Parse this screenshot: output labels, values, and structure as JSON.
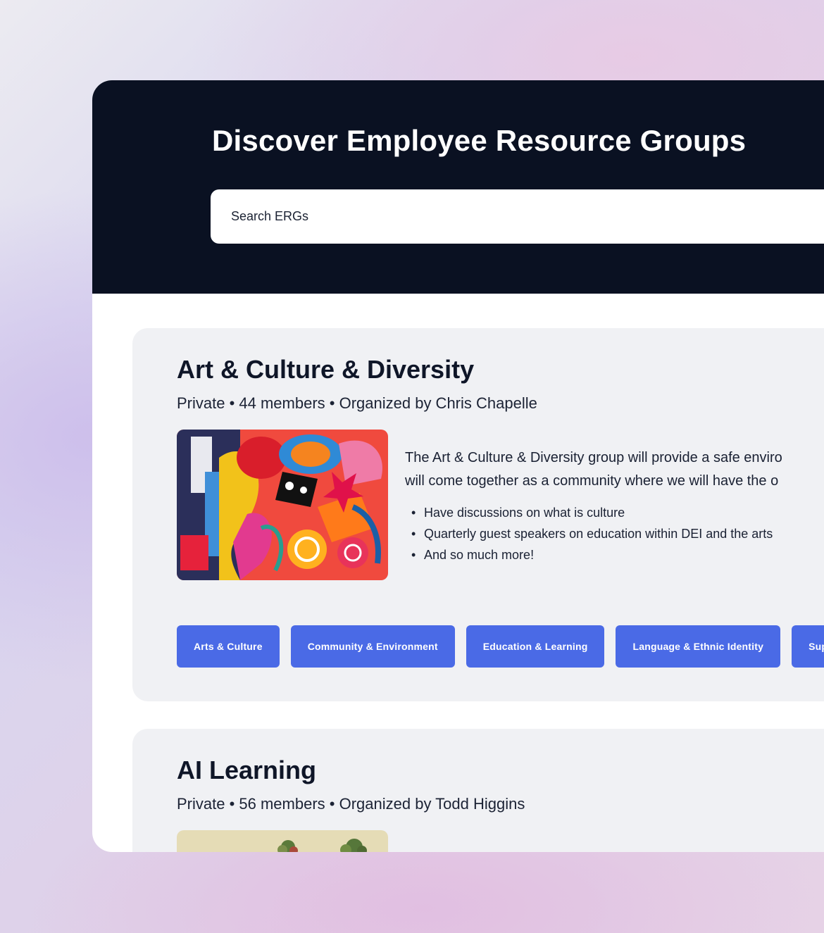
{
  "header": {
    "title": "Discover Employee Resource Groups",
    "search_placeholder": "Search ERGs"
  },
  "groups": [
    {
      "name": "Art & Culture & Diversity",
      "meta": "Private • 44 members • Organized by Chris Chapelle",
      "image": "abstract-colorful-painting",
      "description_lines": [
        "The Art & Culture & Diversity group will provide a safe enviro",
        "will come together as a community where we will have the o"
      ],
      "bullets": [
        "Have discussions on what is culture",
        "Quarterly guest speakers on education within DEI and the arts",
        "And so much more!"
      ],
      "tags": [
        "Arts & Culture",
        "Community & Environment",
        "Education & Learning",
        "Language & Ethnic Identity",
        "Suppo"
      ]
    },
    {
      "name": "AI Learning",
      "meta": "Private • 56 members • Organized by Todd Higgins",
      "image": "plants-photo"
    }
  ],
  "colors": {
    "hero_bg": "#0a1122",
    "card_bg": "#f0f1f4",
    "tag_bg": "#4a6ae6",
    "title_text": "#0f1628"
  }
}
